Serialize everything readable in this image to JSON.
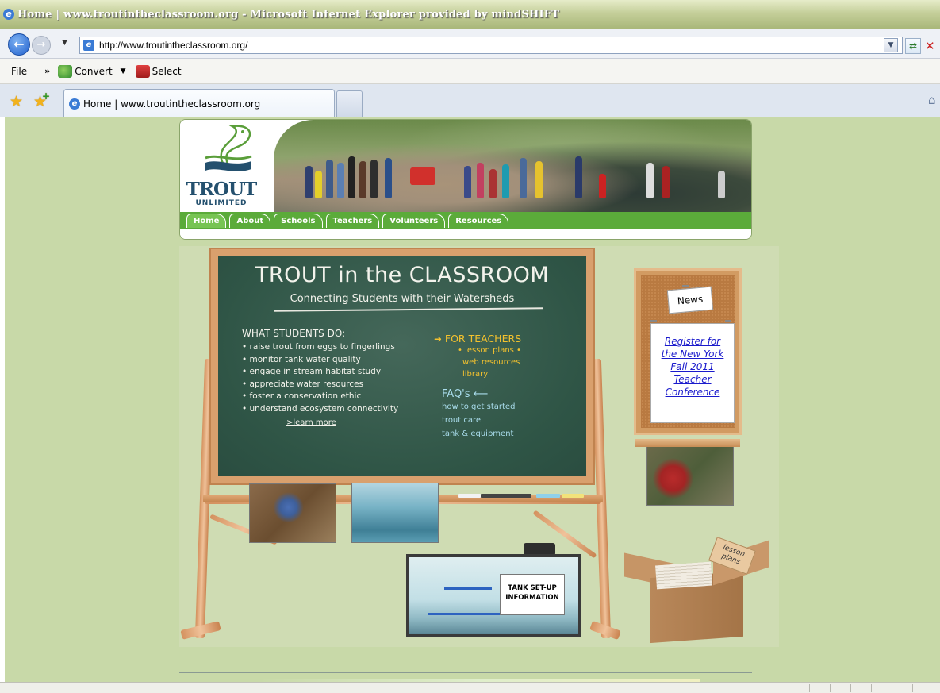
{
  "window": {
    "title": "Home | www.troutintheclassroom.org - Microsoft Internet Explorer provided by mindSHIFT"
  },
  "address_bar": {
    "url": "http://www.troutintheclassroom.org/"
  },
  "menu": {
    "file": "File",
    "overflow": "»",
    "convert": "Convert",
    "select": "Select"
  },
  "tabs": {
    "active_label": "Home | www.troutintheclassroom.org"
  },
  "site": {
    "logo_text": "TROUT",
    "logo_sub": "UNLIMITED",
    "nav": [
      "Home",
      "About",
      "Schools",
      "Teachers",
      "Volunteers",
      "Resources"
    ]
  },
  "chalkboard": {
    "title": "TROUT in the CLASSROOM",
    "subtitle": "Connecting Students with their Watersheds",
    "students_heading": "WHAT STUDENTS DO:",
    "students_items": [
      "• raise trout from eggs to fingerlings",
      "• monitor tank water quality",
      "• engage in stream habitat study",
      "• appreciate water resources",
      "• foster a conservation ethic",
      "• understand ecosystem connectivity"
    ],
    "learn_more": ">learn more",
    "teachers_heading": "FOR TEACHERS",
    "teachers_items": [
      "• lesson plans •",
      "web resources",
      "library"
    ],
    "faq_heading": "FAQ's ⟵",
    "faq_items": [
      "how to get started",
      "trout care",
      "tank & equipment"
    ]
  },
  "tank": {
    "label_line1": "TANK SET-UP",
    "label_line2": "INFORMATION"
  },
  "news": {
    "heading": "News",
    "link": "Register for the New York Fall 2011 Teacher Conference"
  },
  "box": {
    "tag": "lesson plans"
  }
}
